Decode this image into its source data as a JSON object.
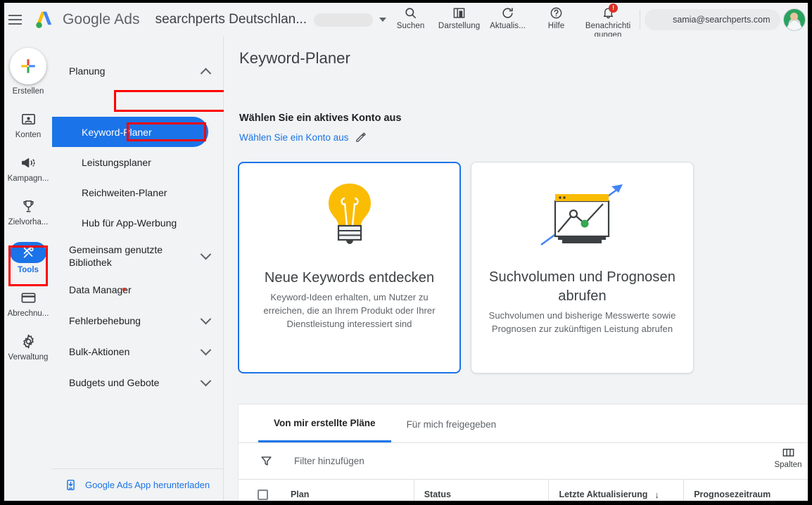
{
  "header": {
    "menu_icon": "hamburger-icon",
    "logo_icon": "google-ads-logo",
    "brand_google": "Google",
    "brand_ads": "Ads",
    "account_name": "searchperts Deutschlan...",
    "account_id_redacted": "",
    "tools": [
      {
        "label": "Suchen",
        "icon": "search-icon"
      },
      {
        "label": "Darstellung",
        "icon": "chart-icon"
      },
      {
        "label": "Aktualis...",
        "icon": "refresh-icon"
      },
      {
        "label": "Hilfe",
        "icon": "help-icon"
      },
      {
        "label": "Benachrichti gungen",
        "icon": "bell-icon",
        "badge": "!"
      }
    ],
    "email": "samia@searchperts.com",
    "avatar_icon": "user-avatar"
  },
  "rail": {
    "items": [
      {
        "label": "Erstellen",
        "icon": "plus-icon",
        "selected": false
      },
      {
        "label": "Konten",
        "icon": "accounts-icon",
        "selected": false
      },
      {
        "label": "Kampagn...",
        "icon": "megaphone-icon",
        "selected": false
      },
      {
        "label": "Zielvorha...",
        "icon": "trophy-icon",
        "selected": false
      },
      {
        "label": "Tools",
        "icon": "tools-icon",
        "selected": true
      },
      {
        "label": "Abrechnu...",
        "icon": "billing-card-icon",
        "selected": false
      },
      {
        "label": "Verwaltung",
        "icon": "gear-icon",
        "selected": false
      }
    ]
  },
  "sidebar": {
    "group_planung": "Planung",
    "selected_item": "Keyword-Planer",
    "sub_items": [
      {
        "label": "Leistungsplaner"
      },
      {
        "label": "Reichweiten-Planer"
      },
      {
        "label": "Hub für App-Werbung"
      }
    ],
    "groups": [
      {
        "label": "Gemeinsam genutzte Bibliothek",
        "expandable": true
      },
      {
        "label": "Data Manager",
        "expandable": false,
        "badge_dot": true
      },
      {
        "label": "Fehlerbehebung",
        "expandable": true
      },
      {
        "label": "Bulk-Aktionen",
        "expandable": true
      },
      {
        "label": "Budgets und Gebote",
        "expandable": true
      }
    ],
    "app_download": "Google Ads App herunterladen",
    "app_download_icon": "mobile-download-icon"
  },
  "main": {
    "page_title": "Keyword-Planer",
    "account_prompt": "Wählen Sie ein aktives Konto aus",
    "account_link": "Wählen Sie ein Konto aus",
    "account_link_icon": "pencil-icon",
    "cards": [
      {
        "title": "Neue Keywords entdecken",
        "description": "Keyword-Ideen erhalten, um Nutzer zu erreichen, die an Ihrem Produkt oder Ihrer Dienstleistung interessiert sind",
        "art": "lightbulb-illustration",
        "selected": true
      },
      {
        "title": "Suchvolumen und Prognosen abrufen",
        "description": "Suchvolumen und bisherige Messwerte sowie Prognosen zur zukünftigen Leistung abrufen",
        "art": "chart-window-illustration",
        "selected": false
      }
    ]
  },
  "panel": {
    "tabs": [
      {
        "label": "Von mir erstellte Pläne",
        "active": true
      },
      {
        "label": "Für mich freigegeben",
        "active": false
      }
    ],
    "filter_label": "Filter hinzufügen",
    "filter_icon": "filter-icon",
    "columns_label": "Spalten",
    "columns_icon": "columns-icon",
    "table_headers": {
      "plan": "Plan",
      "status": "Status",
      "updated": "Letzte Aktualisierung",
      "sort_arrow": "↓",
      "forecast": "Prognosezeitraum"
    }
  },
  "colors": {
    "accent": "#1a73e8",
    "highlight": "#ff0000",
    "bg": "#f1f3f4",
    "yellow": "#fbbc04",
    "green": "#34a853"
  }
}
